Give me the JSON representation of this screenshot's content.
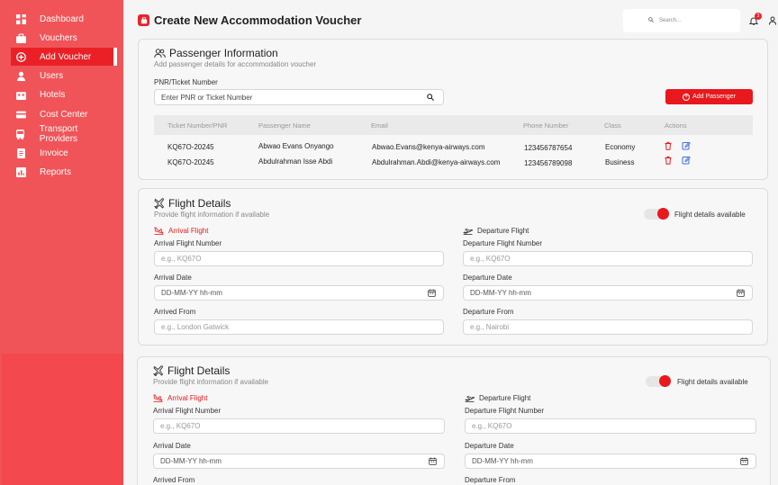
{
  "sidebar": {
    "items": [
      {
        "label": "Dashboard",
        "icon": "dashboard-icon"
      },
      {
        "label": "Vouchers",
        "icon": "briefcase-icon"
      },
      {
        "label": "Add Voucher",
        "icon": "plus-circle-icon",
        "active": true
      },
      {
        "label": "Users",
        "icon": "user-icon"
      },
      {
        "label": "Hotels",
        "icon": "hotel-icon"
      },
      {
        "label": "Cost Center",
        "icon": "card-icon"
      },
      {
        "label": "Transport Providers",
        "icon": "bus-icon"
      },
      {
        "label": "Invoice",
        "icon": "invoice-icon"
      },
      {
        "label": "Reports",
        "icon": "chart-icon"
      }
    ]
  },
  "header": {
    "title": "Create New Accommodation Voucher",
    "search_placeholder": "Search...",
    "notification_count": "3"
  },
  "passenger": {
    "title": "Passenger Information",
    "subtitle": "Add passenger details for accommodation voucher",
    "pnr_label": "PNR/Ticket Number",
    "pnr_placeholder": "Enter PNR or Ticket Number",
    "add_button": "Add Passenger",
    "columns": [
      "Ticket Number/PNR",
      "Passenger Name",
      "Email",
      "Phone Number",
      "Class",
      "Actions"
    ],
    "rows": [
      {
        "ticket": "KQ67O-20245",
        "name": "Abwao Evans Onyango",
        "email": "Abwao.Evans@kenya-airways.com",
        "phone": "123456787654",
        "class": "Economy"
      },
      {
        "ticket": "KQ67O-20245",
        "name": "Abdulrahman Isse Abdi",
        "email": "Abdulrahman.Abdi@kenya-airways.com",
        "phone": "123456789098",
        "class": "Business"
      }
    ]
  },
  "flights": [
    {
      "title": "Flight Details",
      "subtitle": "Provide flight information if available",
      "toggle_label": "Flight details available",
      "toggle_on": true,
      "arrival_heading": "Arrival Flight",
      "arrival_number_label": "Arrival Flight Number",
      "arrival_number_placeholder": "e.g., KQ67O",
      "arrival_date_label": "Arrival Date",
      "arrival_date_placeholder": "DD-MM-YY hh-mm",
      "arrived_from_label": "Arrived From",
      "arrived_from_placeholder": "e.g., London Gatwick",
      "departure_heading": "Departure Flight",
      "departure_number_label": "Departure Flight Number",
      "departure_number_placeholder": "e.g., KQ67O",
      "departure_date_label": "Departure Date",
      "departure_date_placeholder": "DD-MM-YY hh-mm",
      "departure_from_label": "Departure From",
      "departure_from_placeholder": "e.g., Nairobi"
    },
    {
      "title": "Flight Details",
      "subtitle": "Provide flight information if available",
      "toggle_label": "Flight details available",
      "toggle_on": true,
      "arrival_heading": "Arrival Flight",
      "arrival_number_label": "Arrival Flight Number",
      "arrival_number_placeholder": "e.g., KQ67O",
      "arrival_date_label": "Arrival Date",
      "arrival_date_placeholder": "DD-MM-YY hh-mm",
      "arrived_from_label": "Arrived From",
      "departure_heading": "Departure Flight",
      "departure_number_label": "Departure Flight Number",
      "departure_number_placeholder": "e.g., KQ67O",
      "departure_date_label": "Departure Date",
      "departure_date_placeholder": "DD-MM-YY hh-mm",
      "departure_from_label": "Departure From"
    }
  ],
  "colors": {
    "sidebar": "#f05458",
    "accent": "#e8181d",
    "edit": "#3d6fe0"
  }
}
